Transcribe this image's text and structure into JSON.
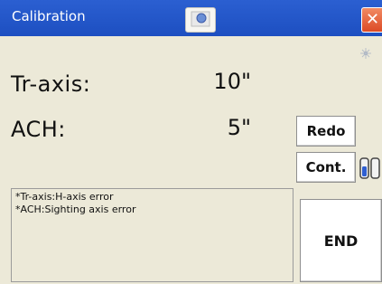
{
  "window": {
    "title": "Calibration",
    "close_label": "✕"
  },
  "rows": [
    {
      "label": "Tr-axis:",
      "value": "10\""
    },
    {
      "label": "ACH:",
      "value": "5\""
    }
  ],
  "buttons": {
    "redo": "Redo",
    "cont": "Cont.",
    "end": "END"
  },
  "notes": [
    "*Tr-axis:H-axis error",
    "*ACH:Sighting axis error"
  ],
  "icons": {
    "center": "level-bubble-icon",
    "indicator": "sun-burst-icon",
    "battery": "battery-icon"
  }
}
